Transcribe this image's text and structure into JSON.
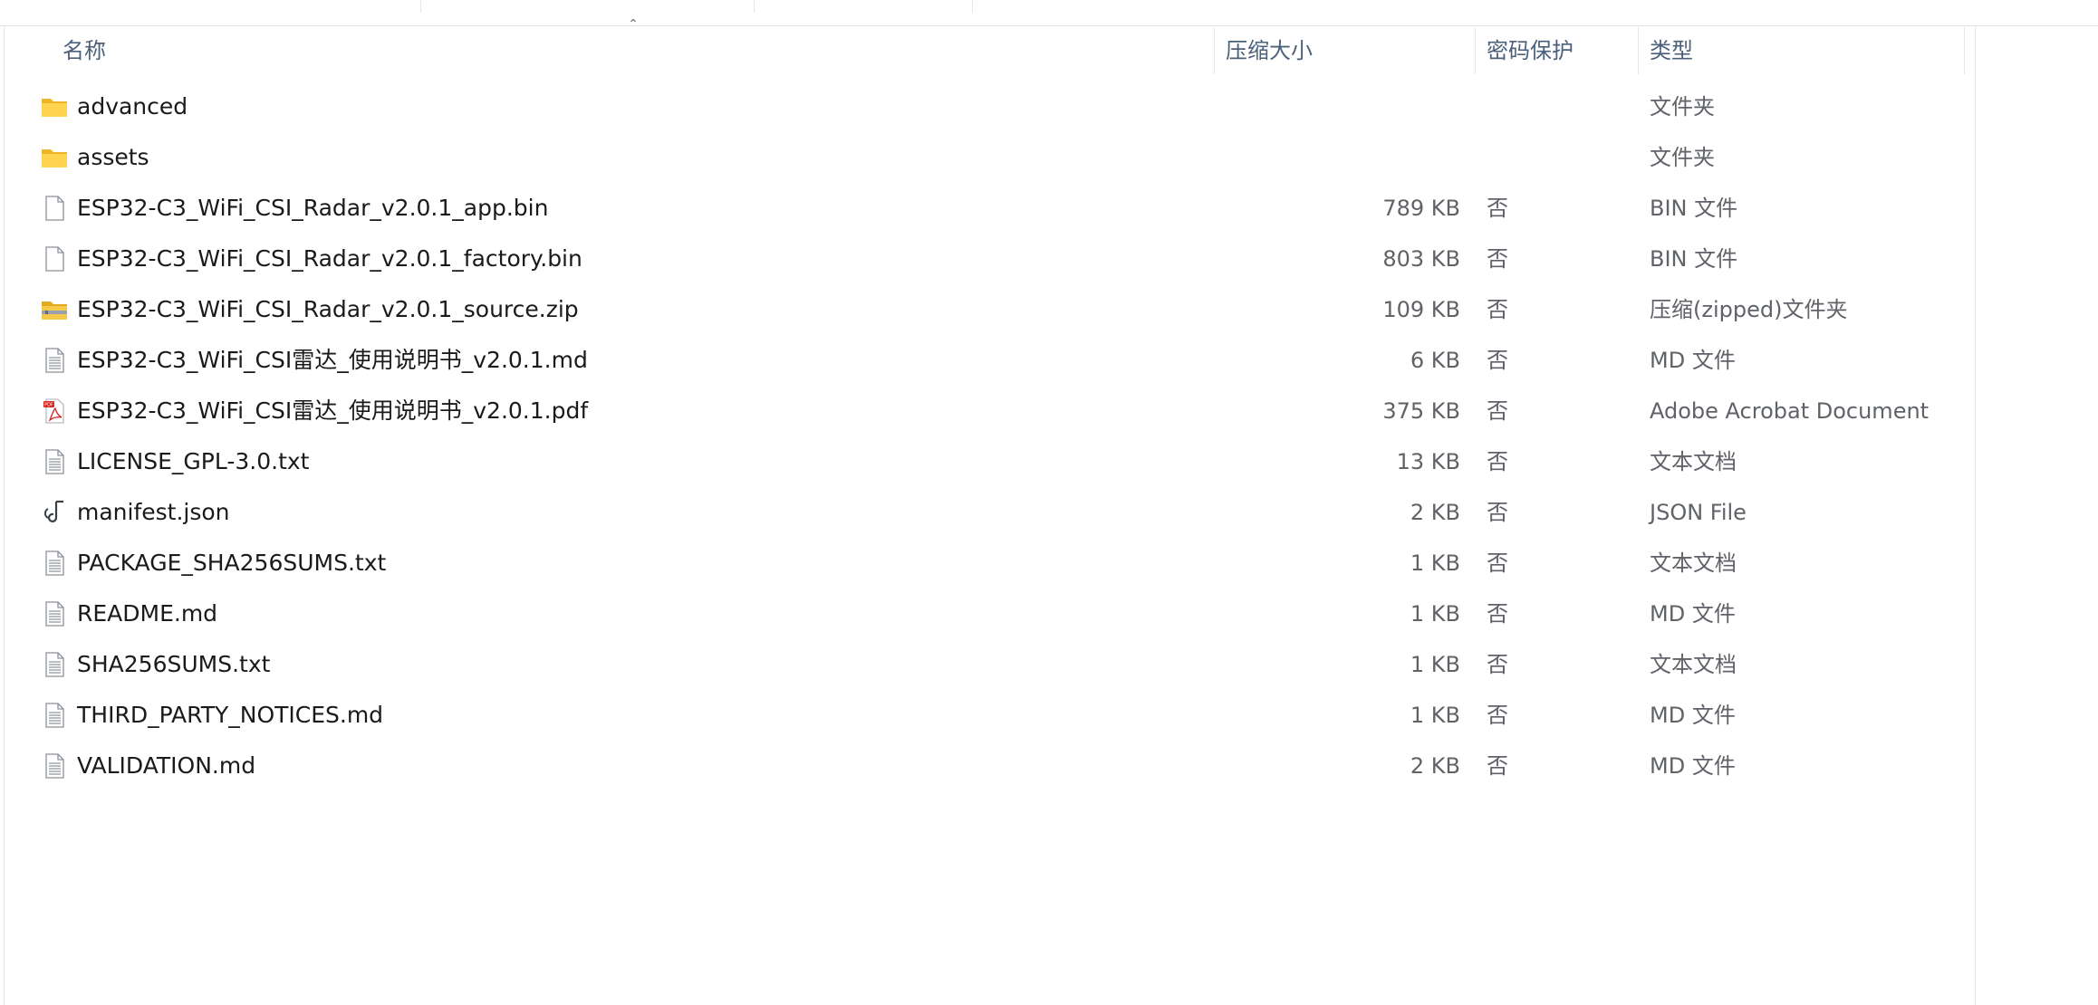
{
  "columns": {
    "name": "名称",
    "size": "压缩大小",
    "protected": "密码保护",
    "type": "类型"
  },
  "files": [
    {
      "name": "advanced",
      "size": "",
      "protected": "",
      "type": "文件夹",
      "icon": "folder-icon"
    },
    {
      "name": "assets",
      "size": "",
      "protected": "",
      "type": "文件夹",
      "icon": "folder-icon"
    },
    {
      "name": "ESP32-C3_WiFi_CSI_Radar_v2.0.1_app.bin",
      "size": "789 KB",
      "protected": "否",
      "type": "BIN 文件",
      "icon": "blank-file-icon"
    },
    {
      "name": "ESP32-C3_WiFi_CSI_Radar_v2.0.1_factory.bin",
      "size": "803 KB",
      "protected": "否",
      "type": "BIN 文件",
      "icon": "blank-file-icon"
    },
    {
      "name": "ESP32-C3_WiFi_CSI_Radar_v2.0.1_source.zip",
      "size": "109 KB",
      "protected": "否",
      "type": "压缩(zipped)文件夹",
      "icon": "zip-folder-icon"
    },
    {
      "name": "ESP32-C3_WiFi_CSI雷达_使用说明书_v2.0.1.md",
      "size": "6 KB",
      "protected": "否",
      "type": "MD 文件",
      "icon": "text-file-icon"
    },
    {
      "name": "ESP32-C3_WiFi_CSI雷达_使用说明书_v2.0.1.pdf",
      "size": "375 KB",
      "protected": "否",
      "type": "Adobe Acrobat Document",
      "icon": "pdf-file-icon"
    },
    {
      "name": "LICENSE_GPL-3.0.txt",
      "size": "13 KB",
      "protected": "否",
      "type": "文本文档",
      "icon": "text-file-icon"
    },
    {
      "name": "manifest.json",
      "size": "2 KB",
      "protected": "否",
      "type": "JSON File",
      "icon": "json-file-icon"
    },
    {
      "name": "PACKAGE_SHA256SUMS.txt",
      "size": "1 KB",
      "protected": "否",
      "type": "文本文档",
      "icon": "text-file-icon"
    },
    {
      "name": "README.md",
      "size": "1 KB",
      "protected": "否",
      "type": "MD 文件",
      "icon": "text-file-icon"
    },
    {
      "name": "SHA256SUMS.txt",
      "size": "1 KB",
      "protected": "否",
      "type": "文本文档",
      "icon": "text-file-icon"
    },
    {
      "name": "THIRD_PARTY_NOTICES.md",
      "size": "1 KB",
      "protected": "否",
      "type": "MD 文件",
      "icon": "text-file-icon"
    },
    {
      "name": "VALIDATION.md",
      "size": "2 KB",
      "protected": "否",
      "type": "MD 文件",
      "icon": "text-file-icon"
    }
  ],
  "colors": {
    "header_text": "#4c607a",
    "folder": "#f4c542",
    "pdf": "#d7261e"
  }
}
